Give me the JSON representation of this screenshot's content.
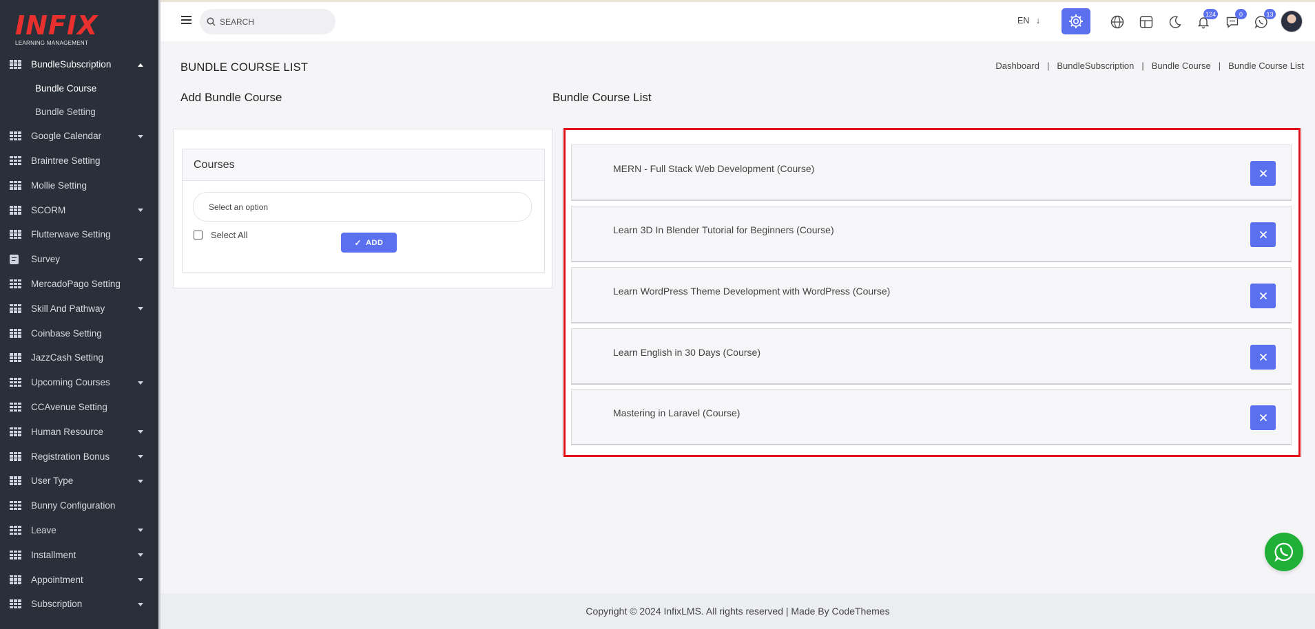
{
  "brand": {
    "logo_text": "INFIX",
    "logo_subtitle": "LEARNING MANAGEMENT"
  },
  "sidebar": {
    "items": [
      {
        "label": "BundleSubscription",
        "icon": "grid-icon",
        "expanded": true,
        "children": [
          {
            "label": "Bundle Course",
            "active": true
          },
          {
            "label": "Bundle Setting"
          }
        ]
      },
      {
        "label": "Google Calendar",
        "icon": "grid-icon",
        "has_caret": true
      },
      {
        "label": "Braintree Setting",
        "icon": "grid-icon"
      },
      {
        "label": "Mollie Setting",
        "icon": "grid-icon"
      },
      {
        "label": "SCORM",
        "icon": "grid-icon",
        "has_caret": true
      },
      {
        "label": "Flutterwave Setting",
        "icon": "grid-icon"
      },
      {
        "label": "Survey",
        "icon": "document-icon",
        "has_caret": true
      },
      {
        "label": "MercadoPago Setting",
        "icon": "grid-icon"
      },
      {
        "label": "Skill And Pathway",
        "icon": "grid-icon",
        "has_caret": true
      },
      {
        "label": "Coinbase Setting",
        "icon": "grid-icon"
      },
      {
        "label": "JazzCash Setting",
        "icon": "grid-icon"
      },
      {
        "label": "Upcoming Courses",
        "icon": "grid-icon",
        "has_caret": true
      },
      {
        "label": "CCAvenue Setting",
        "icon": "grid-icon"
      },
      {
        "label": "Human Resource",
        "icon": "grid-icon",
        "has_caret": true
      },
      {
        "label": "Registration Bonus",
        "icon": "grid-icon",
        "has_caret": true
      },
      {
        "label": "User Type",
        "icon": "grid-icon",
        "has_caret": true
      },
      {
        "label": "Bunny Configuration",
        "icon": "grid-icon"
      },
      {
        "label": "Leave",
        "icon": "grid-icon",
        "has_caret": true
      },
      {
        "label": "Installment",
        "icon": "grid-icon",
        "has_caret": true
      },
      {
        "label": "Appointment",
        "icon": "grid-icon",
        "has_caret": true
      },
      {
        "label": "Subscription",
        "icon": "grid-icon",
        "has_caret": true
      }
    ]
  },
  "topbar": {
    "search_placeholder": "SEARCH",
    "language": "EN",
    "notifications_count": "124",
    "messages_count": "0",
    "chat_count": "13",
    "accent_color": "#5a70ee"
  },
  "page": {
    "title": "BUNDLE COURSE LIST",
    "breadcrumb": [
      "Dashboard",
      "BundleSubscription",
      "Bundle Course",
      "Bundle Course List"
    ],
    "left_title": "Add Bundle Course",
    "right_title": "Bundle Course List"
  },
  "add_form": {
    "box_title": "Courses",
    "select_placeholder": "Select an option",
    "select_all_label": "Select All",
    "add_button": "ADD"
  },
  "course_list": [
    "MERN - Full Stack Web Development (Course)",
    "Learn 3D In Blender Tutorial for Beginners (Course)",
    "Learn WordPress Theme Development with WordPress (Course)",
    "Learn English in 30 Days (Course)",
    "Mastering in Laravel (Course)"
  ],
  "footer": {
    "text": "Copyright © 2024 InfixLMS. All rights reserved | Made By CodeThemes"
  }
}
